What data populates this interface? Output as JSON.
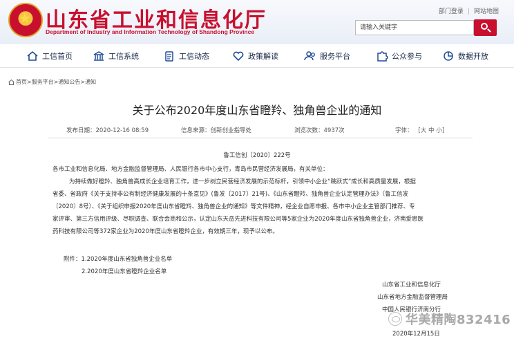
{
  "header": {
    "title": "山东省工业和信息化厅",
    "subtitle": "Department of Industry and Information Technology of Shandong Province",
    "links": [
      "部门登录",
      "网站地图"
    ],
    "search_placeholder": "请输入关键字",
    "brand_color": "#c8102e"
  },
  "nav": {
    "items": [
      {
        "label": "工信首页",
        "icon": "home-icon"
      },
      {
        "label": "工信系统",
        "icon": "building-icon"
      },
      {
        "label": "工信动态",
        "icon": "clipboard-icon"
      },
      {
        "label": "政策解读",
        "icon": "heart-icon"
      },
      {
        "label": "服务平台",
        "icon": "people-icon"
      },
      {
        "label": "公众参与",
        "icon": "puzzle-icon"
      },
      {
        "label": "数据开放",
        "icon": "chart-icon"
      }
    ]
  },
  "breadcrumb": [
    "首页",
    "服务平台",
    "通知公告",
    "通知"
  ],
  "article": {
    "title": "关于公布2020年度山东省瞪羚、独角兽企业的通知",
    "publish_label": "发布日期：",
    "publish_date": "2020-12-16 08:59",
    "source_label": "信息来源：",
    "source": "创新创业指导处",
    "views_label": "浏览次数：",
    "views": "4937次",
    "font_label": "字体：",
    "font_sizes": "[大 中 小]",
    "doc_number": "鲁工信创〔2020〕222号",
    "salutation": "各市工业和信息化局、地方金融监督管理局、人民银行各市中心支行，青岛市民营经济发展局，有关单位：",
    "body_lines": [
      "为持续做好瞪羚、独角兽高成长企业培育工作，进一步树立民营经济发展的示范标杆，引领中小企业“跳跃式”成长和高质量发展，根据",
      "省委、省政府《关于支持非公有制经济健康发展的十条意见》(鲁发〔2017〕21号)、《山东省瞪羚、独角兽企业认定管理办法》（鲁工信发",
      "〔2020〕8号）、《关于组织申报2020年度山东省瞪羚、独角兽企业的通知》等文件精神，经企业自愿申报、各市中小企业主管部门推荐、专",
      "家评审、第三方信用评级、尽职调查、联合会商和公示，认定山东天岳先进科技有限公司等5家企业为2020年度山东省独角兽企业，济南爱思医",
      "药科技有限公司等372家企业为2020年度山东省瞪羚企业，有效期三年，现予以公布。"
    ],
    "attachments": [
      "附件：1.2020年度山东省独角兽企业名单",
      "2.2020年度山东省瞪羚企业名单"
    ],
    "signatures": [
      "山东省工业和信息化厅",
      "山东省地方金融监督管理局",
      "中国人民银行济南分行"
    ],
    "sign_date": "2020年12月15日"
  },
  "watermark": "华美精陶832416"
}
